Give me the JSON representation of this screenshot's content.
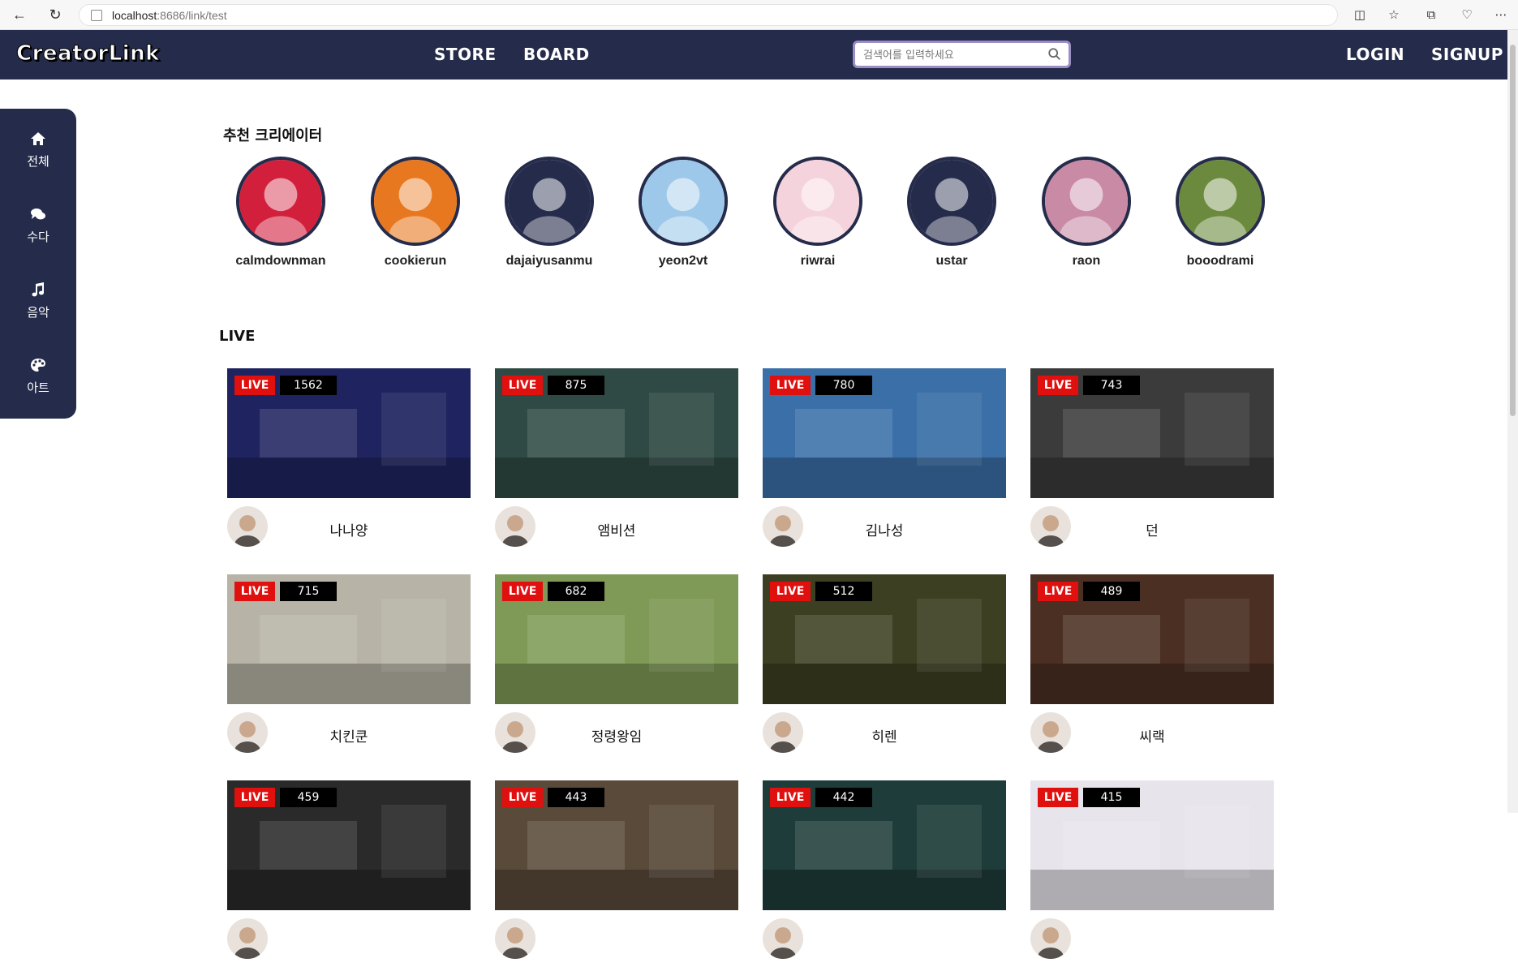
{
  "browser": {
    "url_host": "localhost",
    "url_path": ":8686/link/test"
  },
  "header": {
    "logo": "CreatorLink",
    "nav": [
      {
        "label": "STORE"
      },
      {
        "label": "BOARD"
      }
    ],
    "search_placeholder": "검색어를 입력하세요",
    "login": "LOGIN",
    "signup": "SIGNUP"
  },
  "sidebar": {
    "items": [
      {
        "label": "전체",
        "icon": "home-icon"
      },
      {
        "label": "수다",
        "icon": "chat-icon"
      },
      {
        "label": "음악",
        "icon": "music-icon"
      },
      {
        "label": "아트",
        "icon": "palette-icon"
      }
    ]
  },
  "recommended": {
    "title": "추천 크리에이터",
    "creators": [
      {
        "name": "calmdownman",
        "color": "#d21f3c"
      },
      {
        "name": "cookierun",
        "color": "#e8781f"
      },
      {
        "name": "dajaiyusanmu",
        "color": "#252b4a"
      },
      {
        "name": "yeon2vt",
        "color": "#9dc8ea"
      },
      {
        "name": "riwrai",
        "color": "#f5d3dc"
      },
      {
        "name": "ustar",
        "color": "#252b4a"
      },
      {
        "name": "raon",
        "color": "#c98aa6"
      },
      {
        "name": "booodrami",
        "color": "#6b8a3d"
      }
    ]
  },
  "live": {
    "title": "LIVE",
    "badge": "LIVE",
    "streams": [
      {
        "viewers": "1562",
        "streamer": "나나양",
        "color": "#1f2460"
      },
      {
        "viewers": "875",
        "streamer": "앰비션",
        "color": "#2f4a44"
      },
      {
        "viewers": "780",
        "streamer": "김나성",
        "color": "#3a6fa8"
      },
      {
        "viewers": "743",
        "streamer": "던",
        "color": "#3b3b3b"
      },
      {
        "viewers": "715",
        "streamer": "치킨쿤",
        "color": "#b7b3a6"
      },
      {
        "viewers": "682",
        "streamer": "정령왕임",
        "color": "#7e9a56"
      },
      {
        "viewers": "512",
        "streamer": "히렌",
        "color": "#3d3f22"
      },
      {
        "viewers": "489",
        "streamer": "씨랙",
        "color": "#4a2f22"
      },
      {
        "viewers": "459",
        "streamer": "",
        "color": "#2a2a2a"
      },
      {
        "viewers": "443",
        "streamer": "",
        "color": "#5a4a3a"
      },
      {
        "viewers": "442",
        "streamer": "",
        "color": "#1e3d3a"
      },
      {
        "viewers": "415",
        "streamer": "",
        "color": "#e8e4ec"
      }
    ]
  }
}
